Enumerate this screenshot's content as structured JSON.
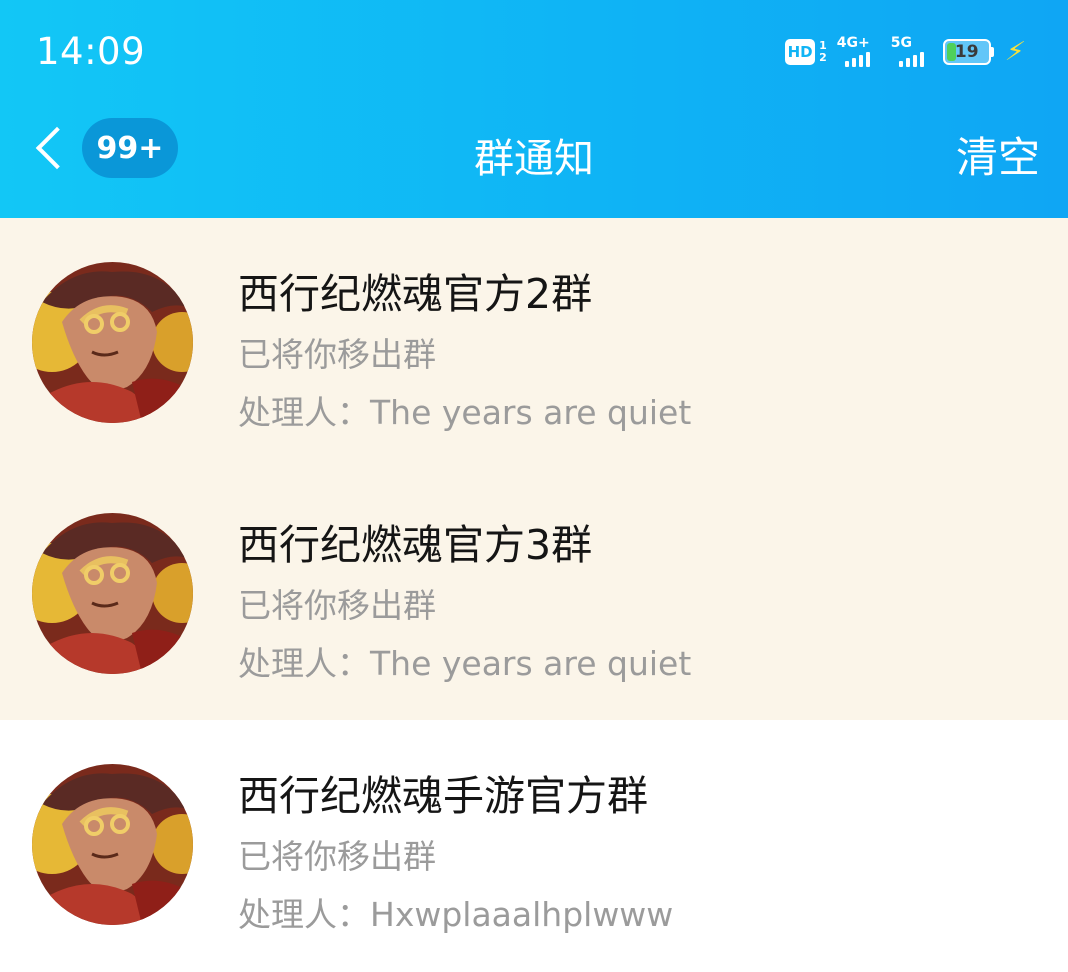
{
  "status_bar": {
    "time": "14:09",
    "hd_label": "HD",
    "hd_sim_1": "1",
    "hd_sim_2": "2",
    "network_1": "4G+",
    "network_2": "5G",
    "battery_level": "19",
    "charging_icon": "bolt-icon"
  },
  "header": {
    "back_icon": "chevron-left-icon",
    "unread_badge": "99+",
    "title": "群通知",
    "clear_label": "清空",
    "bg_color": "#10b4f5"
  },
  "notifications": [
    {
      "group_name": "西行纪燃魂官方2群",
      "message": "已将你移出群",
      "handler_label": "处理人：",
      "handler": "The years are quiet",
      "unread": true
    },
    {
      "group_name": "西行纪燃魂官方3群",
      "message": "已将你移出群",
      "handler_label": "处理人：",
      "handler": "The years are quiet",
      "unread": true
    },
    {
      "group_name": "西行纪燃魂手游官方群",
      "message": "已将你移出群",
      "handler_label": "处理人：",
      "handler": "Hxwplaaalhplwww",
      "unread": false
    }
  ],
  "colors": {
    "unread_bg": "#fbf5e9",
    "read_bg": "#ffffff",
    "secondary_text": "#9b9b9b"
  }
}
